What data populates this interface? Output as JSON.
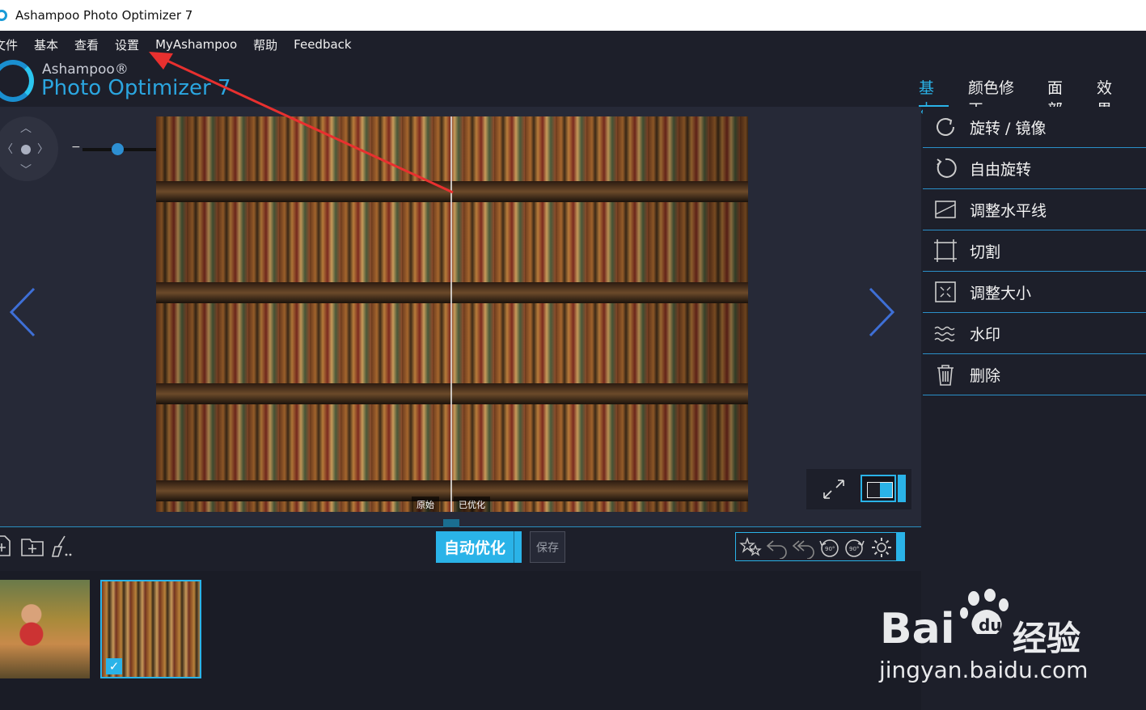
{
  "window": {
    "title": "Ashampoo Photo Optimizer 7"
  },
  "menu": [
    "文件",
    "基本",
    "查看",
    "设置",
    "MyAshampoo",
    "帮助",
    "Feedback"
  ],
  "logo": {
    "small": "Ashampoo®",
    "big": "Photo Optimizer 7"
  },
  "tabs": [
    {
      "label": "基本",
      "active": true
    },
    {
      "label": "颜色修正",
      "active": false
    },
    {
      "label": "面部",
      "active": false
    },
    {
      "label": "效果",
      "active": false
    }
  ],
  "viewer": {
    "zoom_minus": "−",
    "zoom_plus": "+",
    "label_original": "原始",
    "label_optimized": "已优化"
  },
  "panel": {
    "items": [
      {
        "label": "旋转 / 镜像",
        "icon": "rotate-mirror-icon"
      },
      {
        "label": "自由旋转",
        "icon": "free-rotate-icon"
      },
      {
        "label": "调整水平线",
        "icon": "horizon-icon"
      },
      {
        "label": "切割",
        "icon": "crop-icon"
      },
      {
        "label": "调整大小",
        "icon": "resize-icon"
      },
      {
        "label": "水印",
        "icon": "watermark-icon"
      },
      {
        "label": "删除",
        "icon": "trash-icon"
      }
    ]
  },
  "toolbar": {
    "auto_optimize": "自动优化",
    "save": "保存"
  },
  "watermark": {
    "brand": "Bai",
    "brand2": "du",
    "cn": "经验",
    "url": "jingyan.baidu.com"
  },
  "colors": {
    "accent": "#2ab3e8",
    "bg": "#1d1f2a",
    "annotation": "#e8302f"
  }
}
